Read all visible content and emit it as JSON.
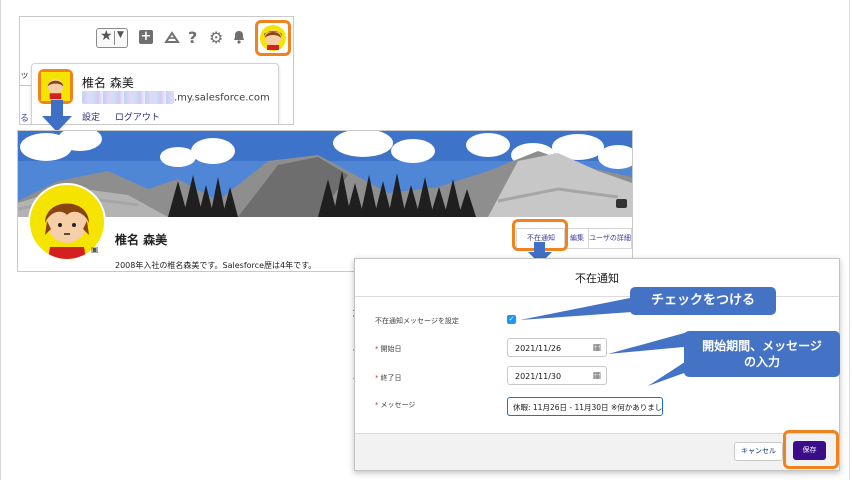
{
  "user_menu": {
    "name": "椎名 森美",
    "email_domain": ".my.salesforce.com",
    "links": [
      "設定",
      "ログアウト"
    ],
    "side_fragments": [
      "ッ",
      "る"
    ]
  },
  "toolbar": {
    "icons": [
      "favorites-star-icon",
      "chevron-down-icon",
      "global-create-icon",
      "trailhead-icon",
      "help-icon",
      "setup-gear-icon",
      "notification-bell-icon",
      "user-avatar"
    ]
  },
  "profile": {
    "name": "椎名 森美",
    "bio": "2008年入社の椎名森美です。Salesforce歴は4年です。",
    "tabs": [
      "不在通知",
      "編集",
      "ユーザの詳細"
    ]
  },
  "dialog": {
    "title": "不在通知",
    "checkbox_label": "不在通知メッセージを設定",
    "checkbox_checked": true,
    "start_label": "開始日",
    "start_value": "2021/11/26",
    "end_label": "終了日",
    "end_value": "2021/11/30",
    "message_label": "メッセージ",
    "message_value": "休暇: 11月26日 - 11月30日 ※何かありまし",
    "cancel_label": "キャンセル",
    "save_label": "保存"
  },
  "callouts": {
    "check": "チェックをつける",
    "period_line1": "開始期間、メッセージ",
    "period_line2": "の入力"
  },
  "background_fragments": [
    "ホ",
    "ス",
    "え"
  ],
  "colors": {
    "highlight_orange": "#f0831d",
    "callout_blue": "#4472c4",
    "save_purple": "#3a0d8a",
    "checkbox_blue": "#1b96ff"
  }
}
